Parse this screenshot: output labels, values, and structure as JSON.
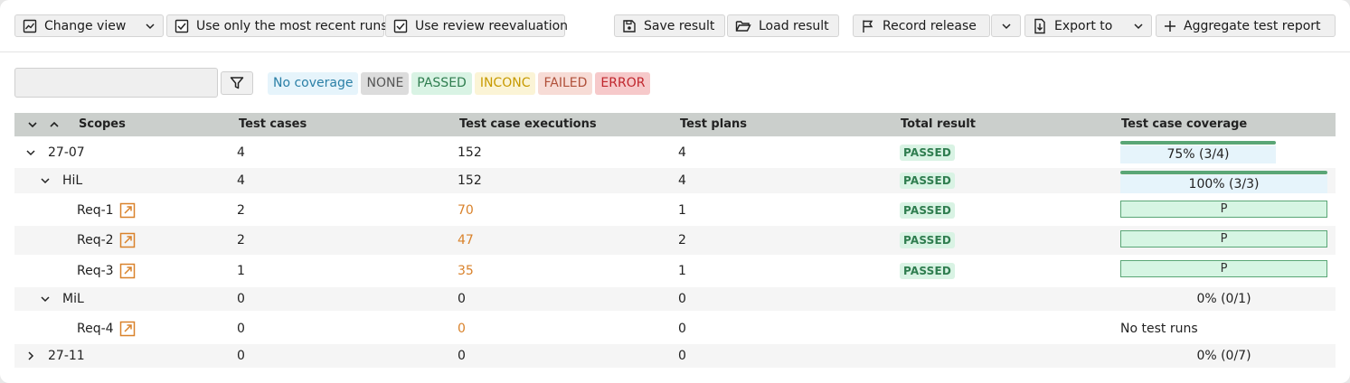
{
  "toolbar": {
    "change_view": "Change view",
    "recent_runs": "Use only the most recent runs",
    "review_reevaluation": "Use review reevaluation",
    "save_result": "Save result",
    "load_result": "Load result",
    "record_release": "Record release",
    "export_to": "Export to",
    "aggregate_report": "Aggregate test report"
  },
  "search": {
    "value": "",
    "placeholder": ""
  },
  "legend": [
    {
      "label": "No coverage",
      "bg": "#e6f4fb",
      "fg": "#2a7fa6"
    },
    {
      "label": "NONE",
      "bg": "#dcdcdc",
      "fg": "#555555"
    },
    {
      "label": "PASSED",
      "bg": "#d9f3e4",
      "fg": "#2f7d4f"
    },
    {
      "label": "INCONC",
      "bg": "#fbf4d6",
      "fg": "#c79a00"
    },
    {
      "label": "FAILED",
      "bg": "#f7dcd6",
      "fg": "#b0503a"
    },
    {
      "label": "ERROR",
      "bg": "#f6c9ca",
      "fg": "#c0262d"
    }
  ],
  "table": {
    "headers": {
      "scopes": "Scopes",
      "test_cases": "Test cases",
      "executions": "Test case executions",
      "plans": "Test plans",
      "total": "Total result",
      "coverage": "Test case coverage"
    },
    "rows": [
      {
        "level": 0,
        "toggle": "open",
        "name": "27-07",
        "cases": "4",
        "executions": "152",
        "exec_link": false,
        "plans": "4",
        "result": "PASSED",
        "coverage": "75% (3/4)",
        "cov_type": "bar",
        "cov_fraction": 0.75
      },
      {
        "level": 1,
        "toggle": "open",
        "name": "HiL",
        "cases": "4",
        "executions": "152",
        "exec_link": false,
        "plans": "4",
        "result": "PASSED",
        "coverage": "100% (3/3)",
        "cov_type": "bar",
        "cov_fraction": 1.0
      },
      {
        "level": 2,
        "toggle": "none",
        "name": "Req-1",
        "link": true,
        "cases": "2",
        "executions": "70",
        "exec_link": true,
        "plans": "1",
        "result": "PASSED",
        "coverage": "P",
        "cov_type": "p"
      },
      {
        "level": 2,
        "toggle": "none",
        "name": "Req-2",
        "link": true,
        "cases": "2",
        "executions": "47",
        "exec_link": true,
        "plans": "2",
        "result": "PASSED",
        "coverage": "P",
        "cov_type": "p"
      },
      {
        "level": 2,
        "toggle": "none",
        "name": "Req-3",
        "link": true,
        "cases": "1",
        "executions": "35",
        "exec_link": true,
        "plans": "1",
        "result": "PASSED",
        "coverage": "P",
        "cov_type": "p"
      },
      {
        "level": 1,
        "toggle": "open",
        "name": "MiL",
        "cases": "0",
        "executions": "0",
        "exec_link": false,
        "plans": "0",
        "result": "",
        "coverage": "0% (0/1)",
        "cov_type": "plain"
      },
      {
        "level": 2,
        "toggle": "none",
        "name": "Req-4",
        "link": true,
        "cases": "0",
        "executions": "0",
        "exec_link": true,
        "plans": "0",
        "result": "",
        "coverage": "No test runs",
        "cov_type": "left"
      },
      {
        "level": 0,
        "toggle": "closed",
        "name": "27-11",
        "cases": "0",
        "executions": "0",
        "exec_link": false,
        "plans": "0",
        "result": "",
        "coverage": "0% (0/7)",
        "cov_type": "plain"
      }
    ]
  },
  "colors": {
    "accent_orange": "#d9822b",
    "passed_green": "#5aa676",
    "header_gray": "#cbcfcc"
  }
}
